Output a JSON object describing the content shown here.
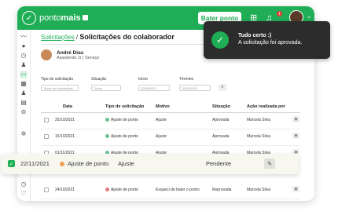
{
  "topbar": {
    "logo_text_a": "ponto",
    "logo_text_b": "mais",
    "bater_ponto": "Bater ponto",
    "notif_count": "1"
  },
  "breadcrumb": {
    "parent": "Solicitações",
    "separator": "/",
    "current": "Solicitações do colaborador"
  },
  "user": {
    "name": "André Dias",
    "role": "Assistente Jr | Serviço"
  },
  "filters": {
    "tipo_label": "Tipo de solicitação",
    "tipo_value": "Todas as solicitações",
    "situacao_label": "Situação",
    "situacao_value": "Todas",
    "inicio_label": "Início",
    "inicio_value": "20/08/2021",
    "termino_label": "Término",
    "termino_value": "20/09/2021"
  },
  "table": {
    "headers": [
      "Data",
      "Tipo de solicitação",
      "Motivo",
      "Situação",
      "Ação realizada por"
    ],
    "rows": [
      {
        "data": "25/10/2021",
        "tipo": "Ajuste de ponto",
        "motivo": "Ajuste",
        "situacao": "Aprovada",
        "acao": "Marcela Silva"
      },
      {
        "data": "15/10/2021",
        "tipo": "Ajuste de ponto",
        "motivo": "Ajuste",
        "situacao": "Aprovada",
        "acao": "Marcela Silva"
      },
      {
        "data": "01/11/2021",
        "tipo": "Ajuste de ponto",
        "motivo": "Ajuste",
        "situacao": "Aprovada",
        "acao": "Marcela Silva"
      },
      {
        "data": "24/10/2021",
        "tipo": "Ajuste de ponto",
        "motivo": "Esqueci de bater o ponto",
        "situacao": "Reprovada",
        "acao": "Marcela Silva"
      }
    ]
  },
  "highlight_row": {
    "data": "22/11/2021",
    "tipo": "Ajuste de ponto",
    "motivo": "Ajuste",
    "situacao": "Pendente"
  },
  "toast": {
    "title": "Tudo certo :)",
    "message": "A solicitação foi aprovada."
  },
  "colors": {
    "brand_green": "#1fae56",
    "toast_bg": "#2c2c2c"
  }
}
